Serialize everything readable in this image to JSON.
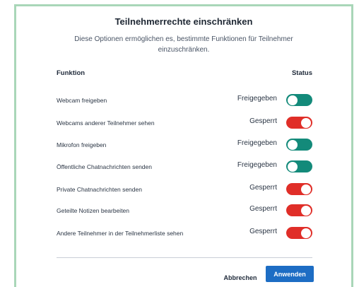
{
  "dialog": {
    "title": "Teilnehmerrechte einschränken",
    "description": "Diese Optionen ermöglichen es, bestimmte Funktionen für Teilnehmer einzuschränken."
  },
  "table": {
    "col_function": "Funktion",
    "col_status": "Status",
    "rows": [
      {
        "label": "Webcam freigeben",
        "status": "Freigegeben",
        "enabled": true
      },
      {
        "label": "Webcams anderer Teilnehmer sehen",
        "status": "Gesperrt",
        "enabled": false
      },
      {
        "label": "Mikrofon freigeben",
        "status": "Freigegeben",
        "enabled": true
      },
      {
        "label": "Öffentliche Chatnachrichten senden",
        "status": "Freigegeben",
        "enabled": true
      },
      {
        "label": "Private Chatnachrichten senden",
        "status": "Gesperrt",
        "enabled": false
      },
      {
        "label": "Geteilte Notizen bearbeiten",
        "status": "Gesperrt",
        "enabled": false
      },
      {
        "label": "Andere Teilnehmer in der Teilnehmerliste sehen",
        "status": "Gesperrt",
        "enabled": false
      }
    ]
  },
  "footer": {
    "cancel_label": "Abbrechen",
    "apply_label": "Anwenden"
  },
  "colors": {
    "toggle_on": "#138a7a",
    "toggle_off": "#e02e28",
    "primary_button": "#1d6dc4",
    "frame_border": "#a9d6b8"
  }
}
